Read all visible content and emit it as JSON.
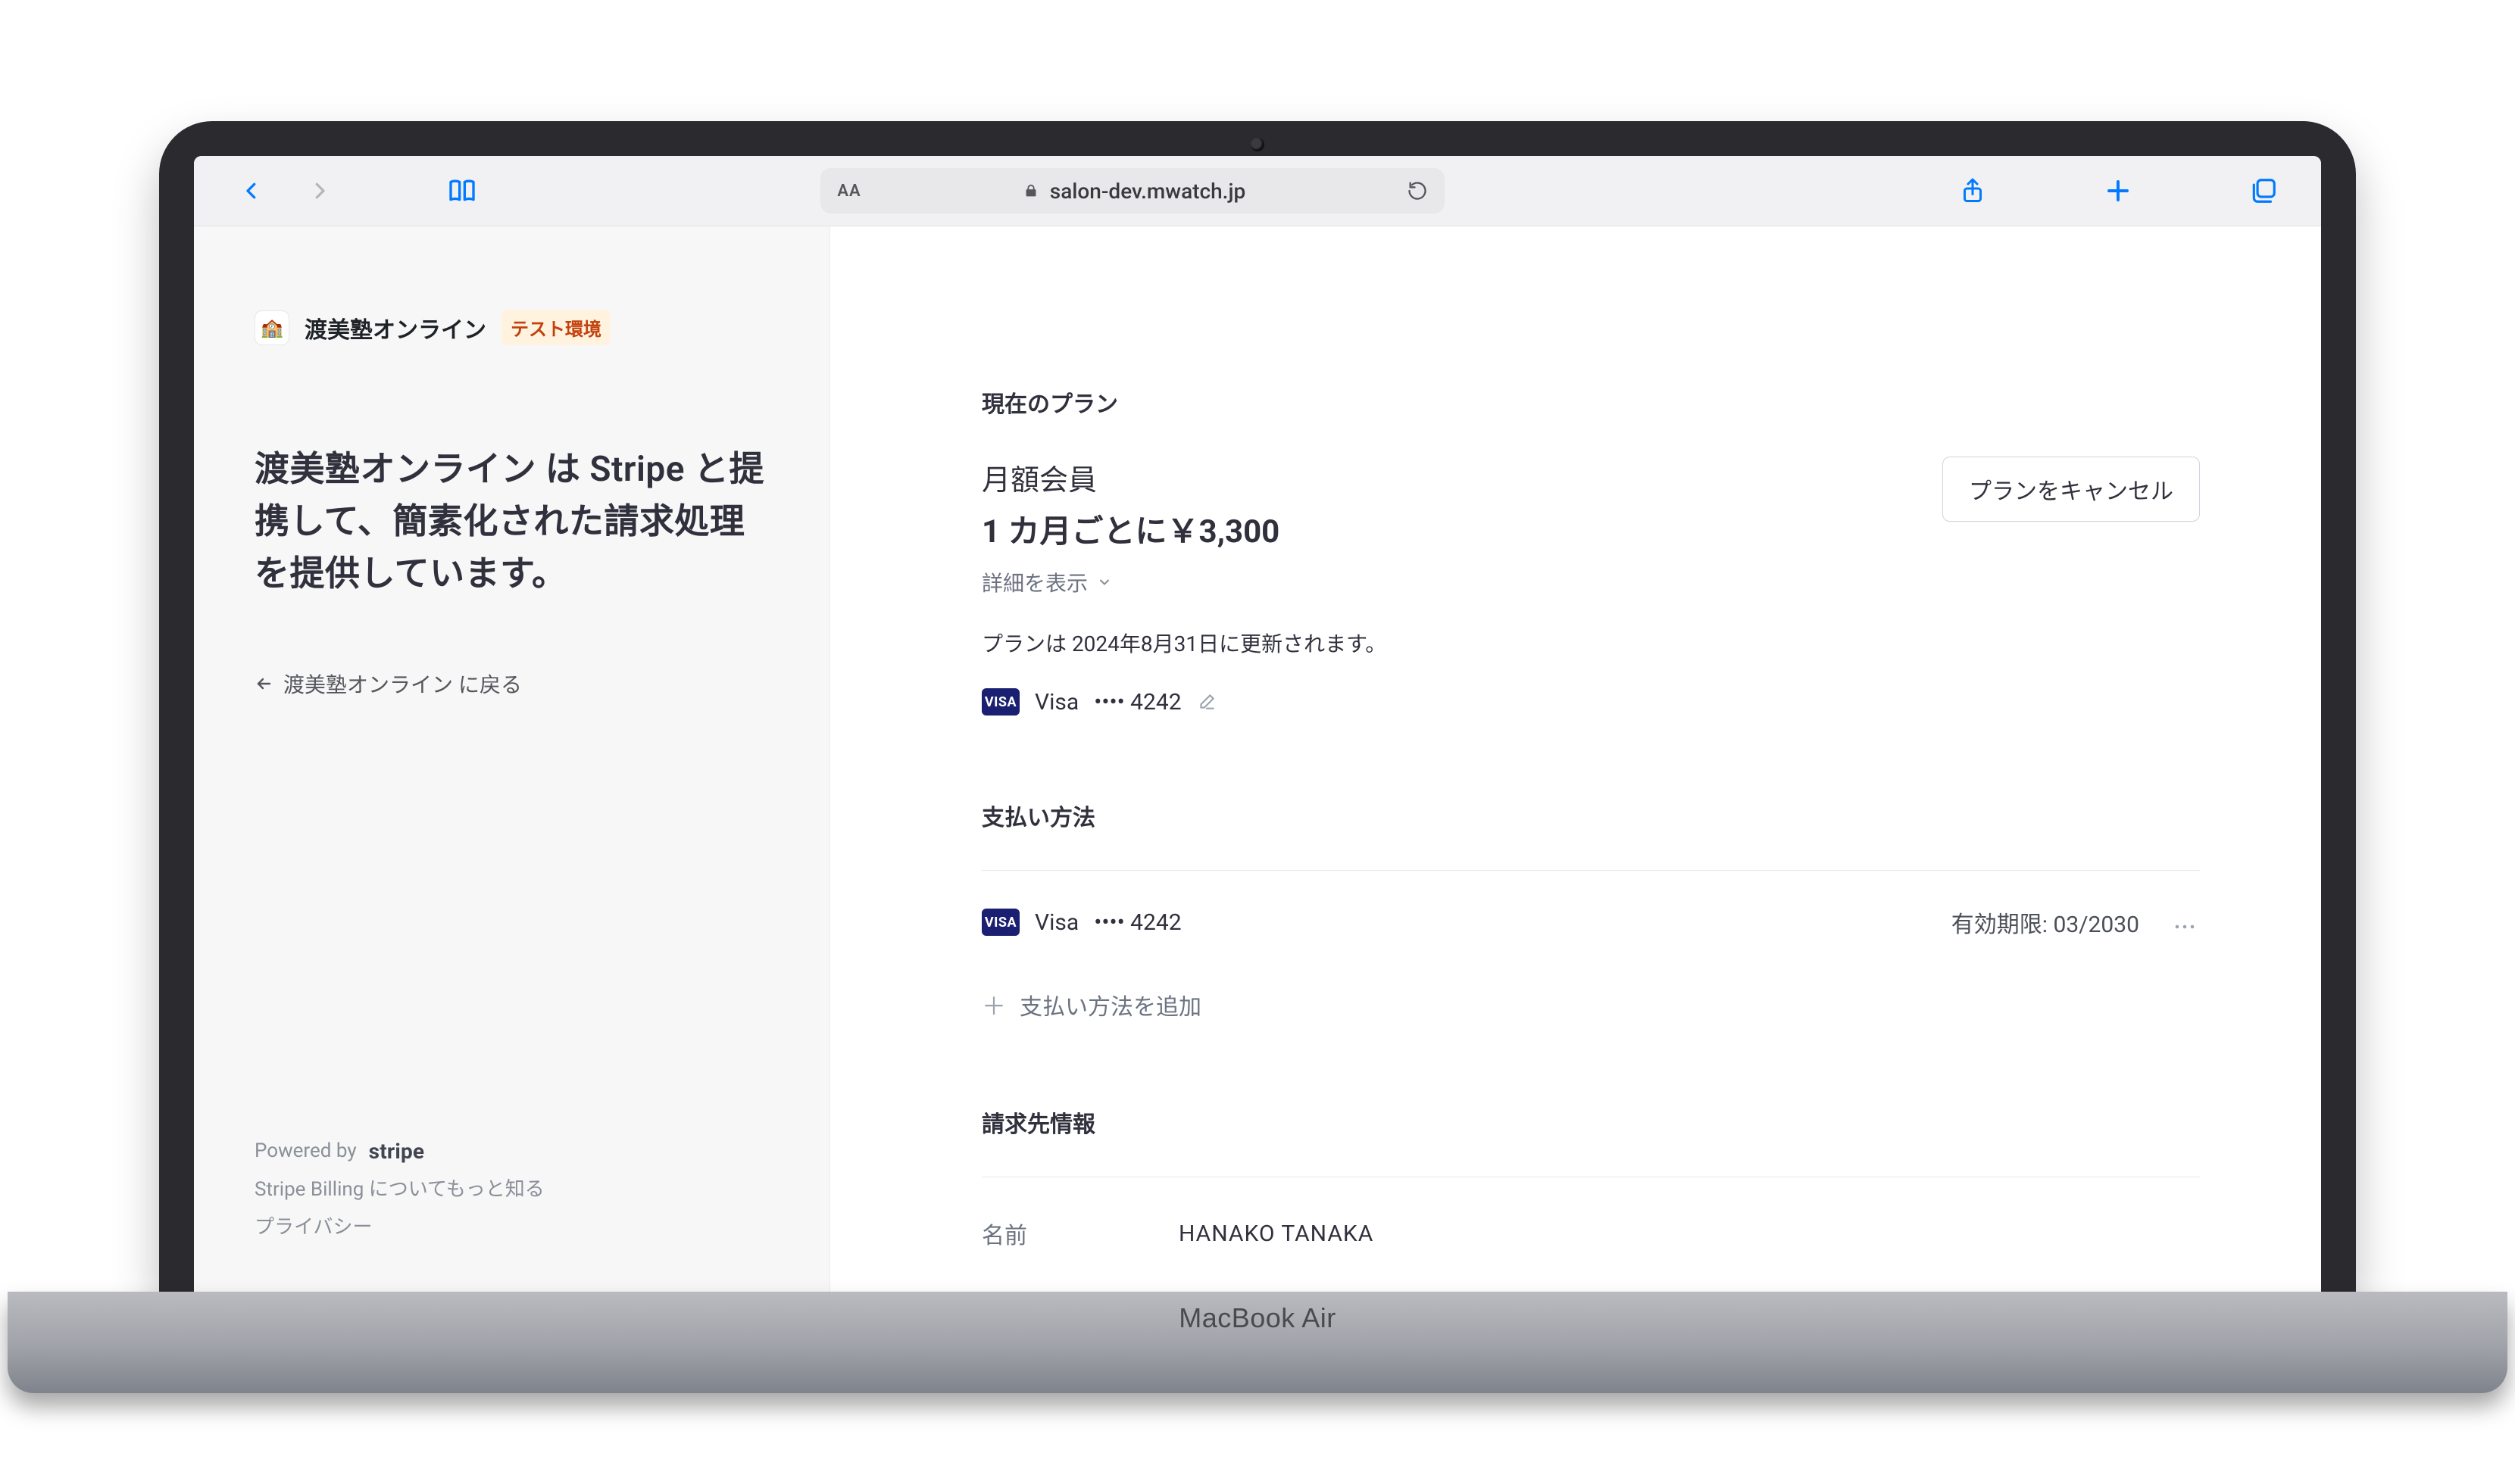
{
  "device_label": "MacBook Air",
  "browser": {
    "text_size_label": "AA",
    "domain": "salon-dev.mwatch.jp"
  },
  "sidebar": {
    "brand_icon": "🏫",
    "brand_name": "渡美塾オンライン",
    "badge": "テスト環境",
    "headline": "渡美塾オンライン は Stripe と提携して、簡素化された請求処理を提供しています。",
    "back_link": "渡美塾オンライン に戻る",
    "powered_by": "Powered by",
    "stripe_word": "stripe",
    "learn_more": "Stripe Billing についてもっと知る",
    "privacy": "プライバシー"
  },
  "main": {
    "current_plan_title": "現在のプラン",
    "plan_name": "月額会員",
    "plan_price": "1 カ月ごとに￥3,300",
    "details_toggle": "詳細を表示",
    "renew_text": "プランは 2024年8月31日に更新されます。",
    "card_brand": "Visa",
    "card_last4": "•••• 4242",
    "cancel_button": "プランをキャンセル",
    "payment_method_title": "支払い方法",
    "pm_brand": "Visa",
    "pm_last4": "•••• 4242",
    "pm_expiry_label": "有効期限:",
    "pm_expiry_value": "03/2030",
    "add_pm": "支払い方法を追加",
    "billing_info_title": "請求先情報",
    "name_label": "名前",
    "name_value": "HANAKO TANAKA"
  }
}
